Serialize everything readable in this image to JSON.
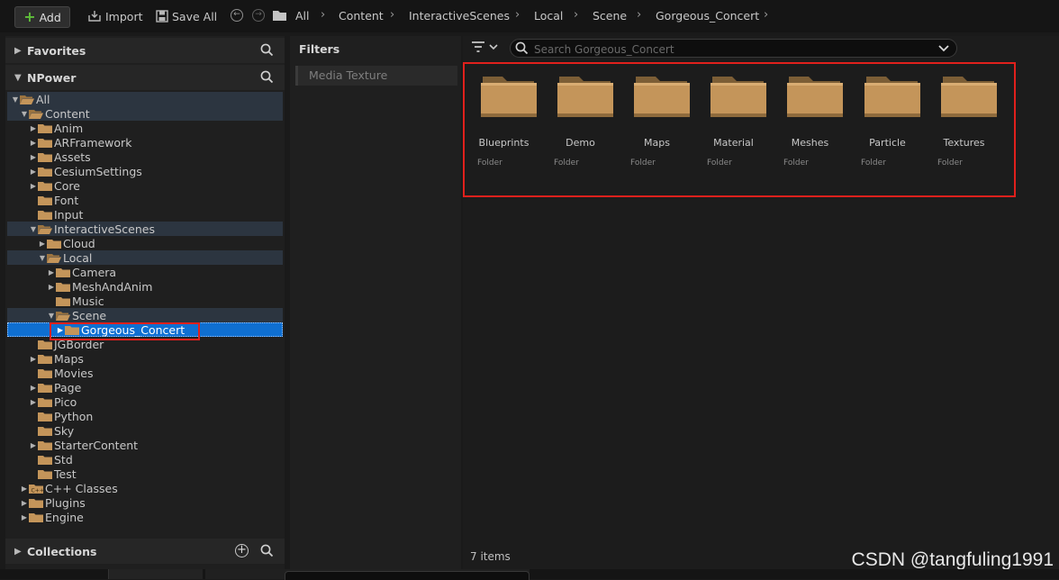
{
  "toolbar": {
    "add_label": "Add",
    "import_label": "Import",
    "save_all_label": "Save All"
  },
  "breadcrumb": [
    "All",
    "Content",
    "InteractiveScenes",
    "Local",
    "Scene",
    "Gorgeous_Concert"
  ],
  "sidebar": {
    "favorites_title": "Favorites",
    "project_title": "NPower",
    "collections_title": "Collections",
    "tree": [
      {
        "label": "All",
        "depth": 0,
        "state": "open",
        "hl": true
      },
      {
        "label": "Content",
        "depth": 1,
        "state": "open",
        "hl": true
      },
      {
        "label": "Anim",
        "depth": 2,
        "state": "closed"
      },
      {
        "label": "ARFramework",
        "depth": 2,
        "state": "closed"
      },
      {
        "label": "Assets",
        "depth": 2,
        "state": "closed"
      },
      {
        "label": "CesiumSettings",
        "depth": 2,
        "state": "closed"
      },
      {
        "label": "Core",
        "depth": 2,
        "state": "closed"
      },
      {
        "label": "Font",
        "depth": 2,
        "state": "none"
      },
      {
        "label": "Input",
        "depth": 2,
        "state": "none"
      },
      {
        "label": "InteractiveScenes",
        "depth": 2,
        "state": "open",
        "hl": true
      },
      {
        "label": "Cloud",
        "depth": 3,
        "state": "closed"
      },
      {
        "label": "Local",
        "depth": 3,
        "state": "open",
        "hl": true
      },
      {
        "label": "Camera",
        "depth": 4,
        "state": "closed"
      },
      {
        "label": "MeshAndAnim",
        "depth": 4,
        "state": "closed"
      },
      {
        "label": "Music",
        "depth": 4,
        "state": "none"
      },
      {
        "label": "Scene",
        "depth": 4,
        "state": "open",
        "hl": true
      },
      {
        "label": "Gorgeous_Concert",
        "depth": 5,
        "state": "closed",
        "sel": true
      },
      {
        "label": "JGBorder",
        "depth": 2,
        "state": "none"
      },
      {
        "label": "Maps",
        "depth": 2,
        "state": "closed"
      },
      {
        "label": "Movies",
        "depth": 2,
        "state": "none"
      },
      {
        "label": "Page",
        "depth": 2,
        "state": "closed"
      },
      {
        "label": "Pico",
        "depth": 2,
        "state": "closed"
      },
      {
        "label": "Python",
        "depth": 2,
        "state": "none"
      },
      {
        "label": "Sky",
        "depth": 2,
        "state": "none"
      },
      {
        "label": "StarterContent",
        "depth": 2,
        "state": "closed"
      },
      {
        "label": "Std",
        "depth": 2,
        "state": "none"
      },
      {
        "label": "Test",
        "depth": 2,
        "state": "none"
      },
      {
        "label": "C++ Classes",
        "depth": 1,
        "state": "closed",
        "icon": "cpp"
      },
      {
        "label": "Plugins",
        "depth": 1,
        "state": "closed"
      },
      {
        "label": "Engine",
        "depth": 1,
        "state": "closed"
      }
    ]
  },
  "filters": {
    "title": "Filters",
    "items": [
      "Media Texture"
    ]
  },
  "content": {
    "search_placeholder": "Search Gorgeous_Concert",
    "tiles": [
      {
        "name": "Blueprints",
        "type": "Folder"
      },
      {
        "name": "Demo",
        "type": "Folder"
      },
      {
        "name": "Maps",
        "type": "Folder"
      },
      {
        "name": "Material",
        "type": "Folder"
      },
      {
        "name": "Meshes",
        "type": "Folder"
      },
      {
        "name": "Particle",
        "type": "Folder"
      },
      {
        "name": "Textures",
        "type": "Folder"
      }
    ],
    "item_count": "7 items"
  },
  "watermark": "CSDN @tangfuling1991",
  "colors": {
    "accent_selection": "#0f6fd1",
    "folder": "#c4955a",
    "annotation_red": "#e0201c",
    "add_green": "#5fbf3a"
  }
}
